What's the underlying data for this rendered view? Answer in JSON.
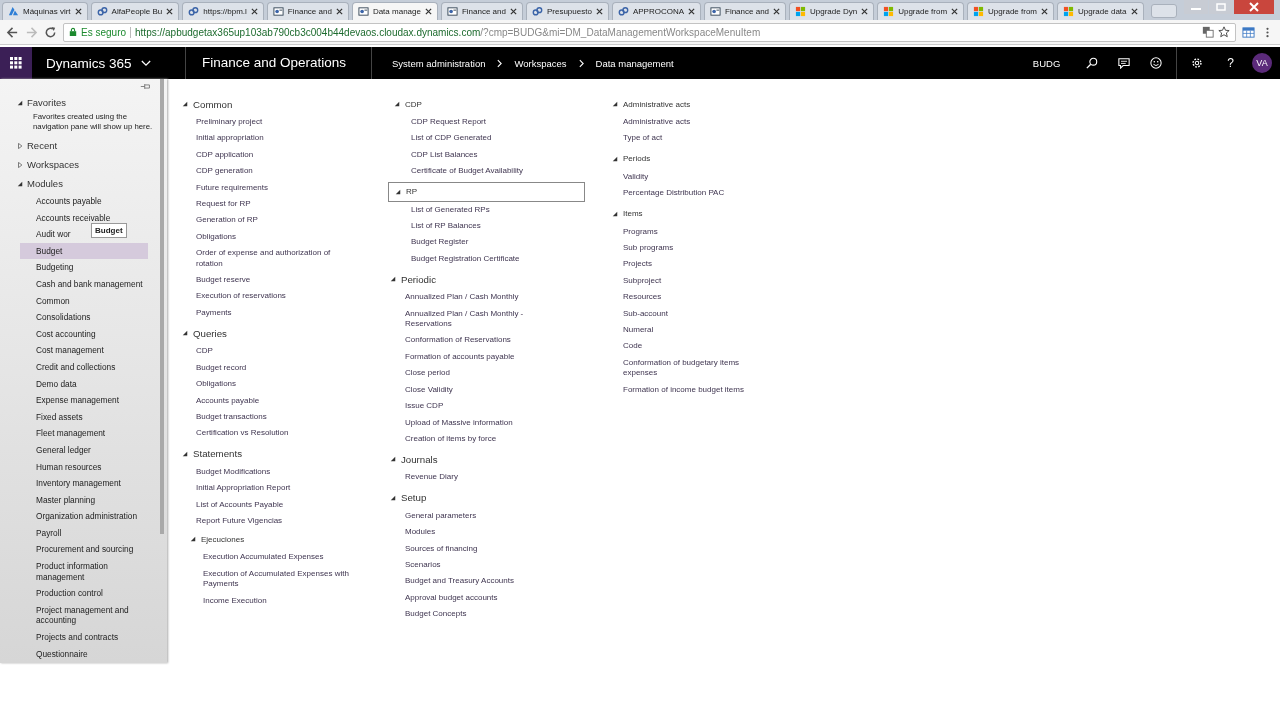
{
  "browser": {
    "tabs": [
      {
        "kind": "azure",
        "title": "Máquinas virt",
        "selected": false
      },
      {
        "kind": "link",
        "title": "AlfaPeople Bu",
        "selected": false
      },
      {
        "kind": "link",
        "title": "https://bpm.l",
        "selected": false
      },
      {
        "kind": "page",
        "title": "Finance and",
        "selected": false
      },
      {
        "kind": "page",
        "title": "Data manage",
        "selected": true
      },
      {
        "kind": "page",
        "title": "Finance and",
        "selected": false
      },
      {
        "kind": "link",
        "title": "Presupuesto",
        "selected": false
      },
      {
        "kind": "link",
        "title": "APPROCONA",
        "selected": false
      },
      {
        "kind": "page",
        "title": "Finance and",
        "selected": false
      },
      {
        "kind": "squares",
        "title": "Upgrade Dyn",
        "selected": false
      },
      {
        "kind": "squares",
        "title": "Upgrade from",
        "selected": false
      },
      {
        "kind": "squares",
        "title": "Upgrade from",
        "selected": false
      },
      {
        "kind": "squares",
        "title": "Upgrade data",
        "selected": false
      }
    ],
    "security_label": "Es seguro",
    "url_host": "https://apbudgetax365up103ab790cb3c004b44devaos.cloudax.dynamics.com",
    "url_path": "/?cmp=BUDG&mi=DM_DataManagementWorkspaceMenuItem"
  },
  "header": {
    "product": "Dynamics 365",
    "app": "Finance and Operations",
    "breadcrumbs": [
      "System administration",
      "Workspaces",
      "Data management"
    ],
    "company": "BUDG",
    "help": "?",
    "avatar": "VA"
  },
  "sidebar": {
    "sections": [
      {
        "title": "Favorites",
        "expanded": true,
        "note": "Favorites created using the navigation pane will show up here."
      },
      {
        "title": "Recent",
        "expanded": false
      },
      {
        "title": "Workspaces",
        "expanded": false
      },
      {
        "title": "Modules",
        "expanded": true,
        "items": [
          {
            "label": "Accounts payable",
            "selected": false
          },
          {
            "label": "Accounts receivable",
            "selected": false
          },
          {
            "label": "Audit wor",
            "selected": false
          },
          {
            "label": "Budget",
            "selected": true
          },
          {
            "label": "Budgeting",
            "selected": false
          },
          {
            "label": "Cash and bank management",
            "selected": false
          },
          {
            "label": "Common",
            "selected": false
          },
          {
            "label": "Consolidations",
            "selected": false
          },
          {
            "label": "Cost accounting",
            "selected": false
          },
          {
            "label": "Cost management",
            "selected": false
          },
          {
            "label": "Credit and collections",
            "selected": false
          },
          {
            "label": "Demo data",
            "selected": false
          },
          {
            "label": "Expense management",
            "selected": false
          },
          {
            "label": "Fixed assets",
            "selected": false
          },
          {
            "label": "Fleet management",
            "selected": false
          },
          {
            "label": "General ledger",
            "selected": false
          },
          {
            "label": "Human resources",
            "selected": false
          },
          {
            "label": "Inventory management",
            "selected": false
          },
          {
            "label": "Master planning",
            "selected": false
          },
          {
            "label": "Organization administration",
            "selected": false
          },
          {
            "label": "Payroll",
            "selected": false
          },
          {
            "label": "Procurement and sourcing",
            "selected": false
          },
          {
            "label": "Product information management",
            "selected": false
          },
          {
            "label": "Production control",
            "selected": false
          },
          {
            "label": "Project management and accounting",
            "selected": false
          },
          {
            "label": "Projects and contracts",
            "selected": false
          },
          {
            "label": "Questionnaire",
            "selected": false
          }
        ]
      }
    ],
    "tooltip": "Budget"
  },
  "columns": [
    [
      {
        "title": "Common",
        "kind": "major",
        "expanded": true,
        "focused": false,
        "items": [
          "Preliminary project",
          "Initial appropriation",
          "CDP application",
          "CDP generation",
          "Future requirements",
          "Request for RP",
          "Generation of RP",
          "Obligations",
          "Order of expense and authorization of rotation",
          "Budget reserve",
          "Execution of reservations",
          "Payments"
        ]
      },
      {
        "title": "Queries",
        "kind": "major",
        "expanded": true,
        "focused": false,
        "items": [
          "CDP",
          "Budget record",
          "Obligations",
          "Accounts payable",
          "Budget transactions",
          "Certification vs Resolution"
        ]
      },
      {
        "title": "Statements",
        "kind": "major",
        "expanded": true,
        "focused": false,
        "items": [
          "Budget Modifications",
          "Initial Appropriation Report",
          "List of Accounts Payable",
          "Report Future Vigencias"
        ],
        "children": [
          {
            "title": "Ejecuciones",
            "kind": "minor",
            "expanded": true,
            "focused": false,
            "items": [
              "Execution Accumulated Expenses",
              "Execution of Accumulated Expenses with Payments",
              "Income Execution"
            ]
          }
        ]
      }
    ],
    [
      {
        "title": "CDP",
        "kind": "minor",
        "expanded": true,
        "focused": false,
        "items": [
          "CDP Request Report",
          "List of CDP Generated",
          "CDP List Balances",
          "Certificate of Budget Availability"
        ]
      },
      {
        "title": "RP",
        "kind": "minor",
        "expanded": true,
        "focused": true,
        "items": [
          "List of Generated RPs",
          "List of RP Balances",
          "Budget Register",
          "Budget Registration Certificate"
        ]
      },
      {
        "title": "Periodic",
        "kind": "major",
        "expanded": true,
        "focused": false,
        "items": [
          "Annualized Plan / Cash Monthly",
          "Annualized Plan / Cash Monthly - Reservations",
          "Conformation of Reservations",
          "Formation of accounts payable",
          "Close period",
          "Close Validity",
          "Issue CDP",
          "Upload of Massive information",
          "Creation of items by force"
        ]
      },
      {
        "title": "Journals",
        "kind": "major",
        "expanded": true,
        "focused": false,
        "items": [
          "Revenue Diary"
        ]
      },
      {
        "title": "Setup",
        "kind": "major",
        "expanded": true,
        "focused": false,
        "items": [
          "General parameters",
          "Modules",
          "Sources of financing",
          "Scenarios",
          "Budget and Treasury Accounts",
          "Approval budget accounts",
          "Budget Concepts"
        ]
      }
    ],
    [
      {
        "title": "Administrative acts",
        "kind": "minor",
        "expanded": true,
        "focused": false,
        "items": [
          "Administrative acts",
          "Type of act"
        ]
      },
      {
        "title": "Periods",
        "kind": "minor",
        "expanded": true,
        "focused": false,
        "items": [
          "Validity",
          "Percentage Distribution PAC"
        ]
      },
      {
        "title": "Items",
        "kind": "minor",
        "expanded": true,
        "focused": false,
        "items": [
          "Programs",
          "Sub programs",
          "Projects",
          "Subproject",
          "Resources",
          "Sub-account",
          "Numeral",
          "Code",
          "Conformation of budgetary items expenses",
          "Formation of income budget items"
        ]
      }
    ]
  ]
}
